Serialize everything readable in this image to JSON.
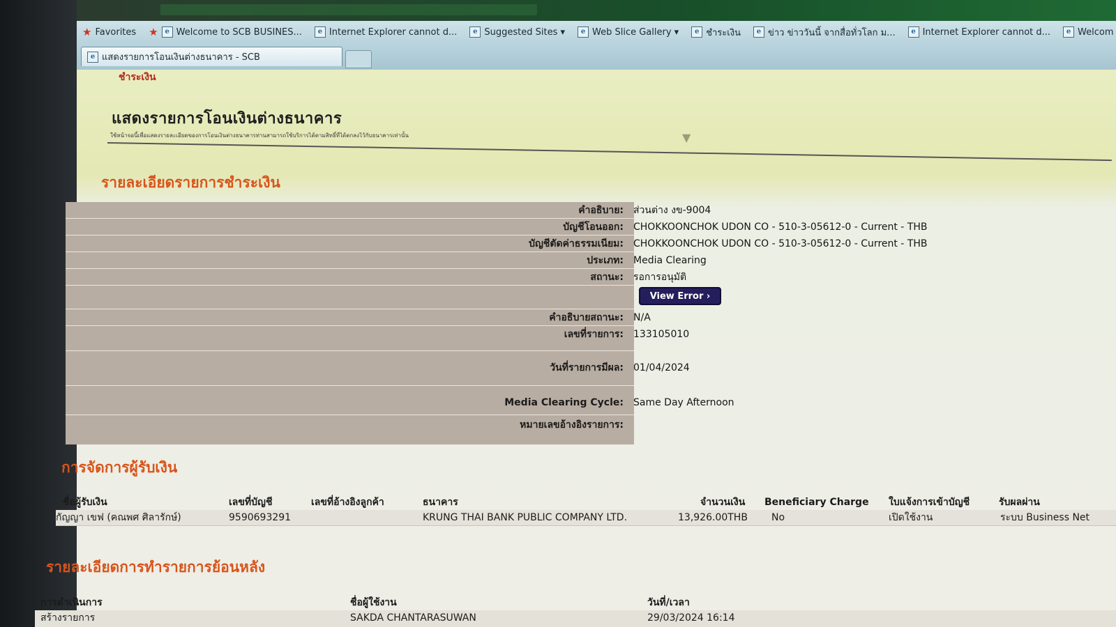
{
  "browser": {
    "favorites_label": "Favorites",
    "favorites": [
      {
        "label": "Welcome to SCB BUSINES..."
      },
      {
        "label": "Internet Explorer cannot d..."
      },
      {
        "label": "Suggested Sites ▾"
      },
      {
        "label": "Web Slice Gallery ▾"
      },
      {
        "label": "ชำระเงิน"
      },
      {
        "label": "ข่าว ข่าววันนี้ จากสื่อทั่วโลก ม..."
      },
      {
        "label": "Internet Explorer cannot d..."
      },
      {
        "label": "Welcom"
      }
    ],
    "tab_title": "แสดงรายการโอนเงินต่างธนาคาร - SCB"
  },
  "page": {
    "breadcrumb": "ชำระเงิน",
    "title": "แสดงรายการโอนเงินต่างธนาคาร",
    "subtitle": "ใช้หน้าจอนี้เพื่อแสดงรายละเอียดของการโอนเงินต่างธนาคารท่านสามารถใช้บริการได้ตามสิทธิ์ที่ได้ตกลงไว้กับธนาคารเท่านั้น",
    "payment_section_title": "รายละเอียดรายการชำระเงิน",
    "payee_section_title": "การจัดการผู้รับเงิน",
    "history_section_title": "รายละเอียดการทำรายการย้อนหลัง"
  },
  "details": {
    "description_label": "คำอธิบาย:",
    "description_value": "ส่วนต่าง งข-9004",
    "debit_account_label": "บัญชีโอนออก:",
    "debit_account_value": "CHOKKOONCHOK UDON CO - 510-3-05612-0 - Current - THB",
    "fee_account_label": "บัญชีตัดค่าธรรมเนียม:",
    "fee_account_value": "CHOKKOONCHOK UDON CO - 510-3-05612-0 - Current - THB",
    "type_label": "ประเภท:",
    "type_value": "Media Clearing",
    "status_label": "สถานะ:",
    "status_value": "รอการอนุมัติ",
    "view_error_button": "View Error ›",
    "status_desc_label": "คำอธิบายสถานะ:",
    "status_desc_value": "N/A",
    "txn_no_label": "เลขที่รายการ:",
    "txn_no_value": "133105010",
    "effective_date_label": "วันที่รายการมีผล:",
    "effective_date_value": "01/04/2024",
    "cycle_label": "Media Clearing Cycle:",
    "cycle_value": "Same Day Afternoon",
    "ref_label": "หมายเลขอ้างอิงรายการ:",
    "ref_value": ""
  },
  "payee_table": {
    "headers": {
      "name": "ชื่อผู้รับเงิน",
      "account": "เลขที่บัญชี",
      "customer_ref": "เลขที่อ้างอิงลูกค้า",
      "bank": "ธนาคาร",
      "amount": "จำนวนเงิน",
      "beneficiary_charge": "Beneficiary Charge",
      "credit_advice": "ใบแจ้งการเข้าบัญชี",
      "receive_via": "รับผลผ่าน"
    },
    "rows": [
      {
        "name": "กัญญา เขฟ (คณพศ ศิลารักษ์)",
        "account": "9590693291",
        "customer_ref": "",
        "bank": "KRUNG THAI BANK PUBLIC COMPANY LTD.",
        "amount": "13,926.00THB",
        "beneficiary_charge": "No",
        "credit_advice": "เปิดใช้งาน",
        "receive_via": "ระบบ Business Net"
      }
    ]
  },
  "history_table": {
    "headers": {
      "action": "การดำเนินการ",
      "user": "ชื่อผู้ใช้งาน",
      "datetime": "วันที่/เวลา"
    },
    "rows": [
      {
        "action": "สร้างรายการ",
        "user": "SAKDA CHANTARASUWAN",
        "datetime": "29/03/2024 16:14"
      }
    ]
  },
  "colors": {
    "section_title": "#d8541a",
    "label_column_bg": "#b8ada2",
    "button_bg": "#241f5c",
    "page_bg": "#e9eec2"
  }
}
